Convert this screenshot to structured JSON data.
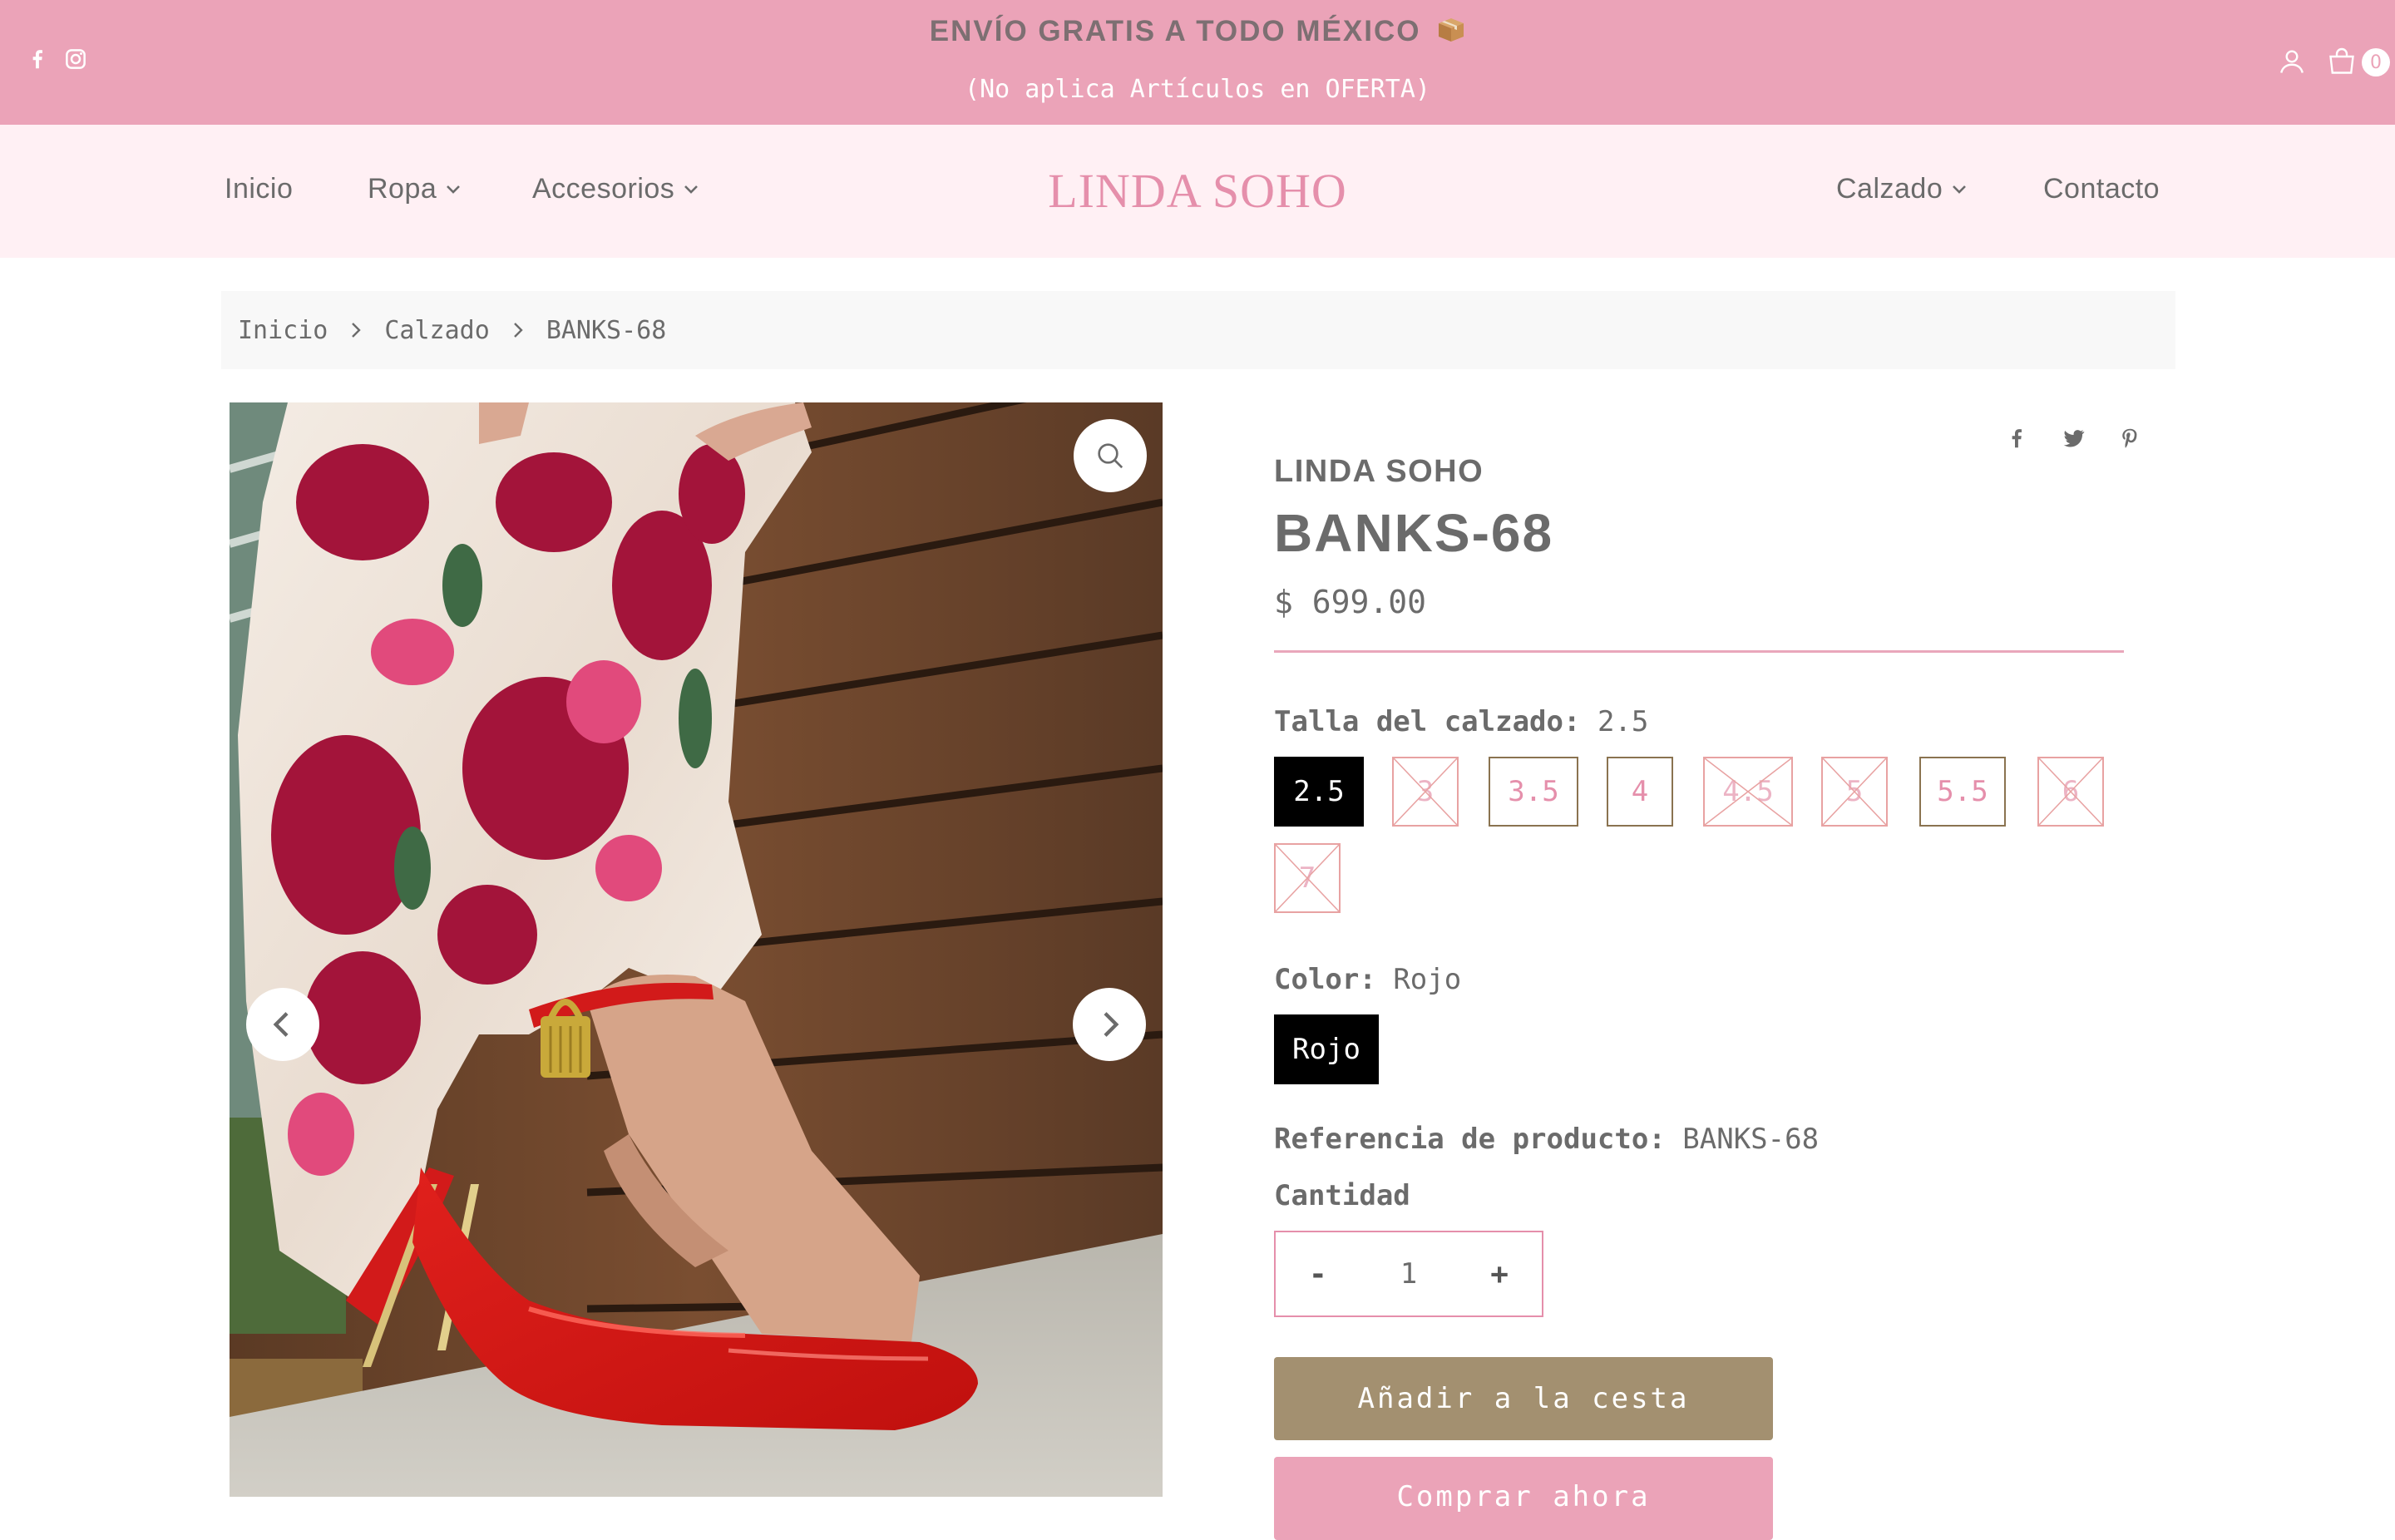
{
  "announcement": {
    "line1": "ENVÍO GRATIS A TODO MÉXICO",
    "line2": "(No aplica Artículos en OFERTA)",
    "social": [
      "facebook-icon",
      "instagram-icon"
    ],
    "cart_count": "0",
    "background": "#eba3b8"
  },
  "nav": {
    "logo": "LINDA SOHO",
    "left": [
      {
        "label": "Inicio"
      },
      {
        "label": "Ropa"
      },
      {
        "label": "Accesorios"
      }
    ],
    "right": [
      {
        "label": "Calzado"
      },
      {
        "label": "Contacto"
      }
    ]
  },
  "breadcrumb": [
    "Inicio",
    "Calzado",
    "BANKS-68"
  ],
  "product": {
    "vendor": "LINDA SOHO",
    "title": "BANKS-68",
    "price": "$ 699.00",
    "size_label": "Talla del calzado:",
    "size_selected": "2.5",
    "sizes": [
      {
        "label": "2.5",
        "state": "selected"
      },
      {
        "label": "3",
        "state": "soldout"
      },
      {
        "label": "3.5",
        "state": "available"
      },
      {
        "label": "4",
        "state": "available"
      },
      {
        "label": "4.5",
        "state": "soldout"
      },
      {
        "label": "5",
        "state": "soldout"
      },
      {
        "label": "5.5",
        "state": "available"
      },
      {
        "label": "6",
        "state": "soldout"
      },
      {
        "label": "7",
        "state": "soldout"
      }
    ],
    "color_label": "Color:",
    "color_selected": "Rojo",
    "color_option": "Rojo",
    "sku_label": "Referencia de producto:",
    "sku": "BANKS-68",
    "quantity_label": "Cantidad",
    "quantity": "1",
    "minus": "-",
    "plus": "+",
    "add_to_cart": "Añadir a la cesta",
    "buy_now": "Comprar ahora"
  },
  "colors": {
    "accent_pink": "#e58fab",
    "nav_bg": "#fff0f4",
    "button_gold": "#a39070"
  }
}
